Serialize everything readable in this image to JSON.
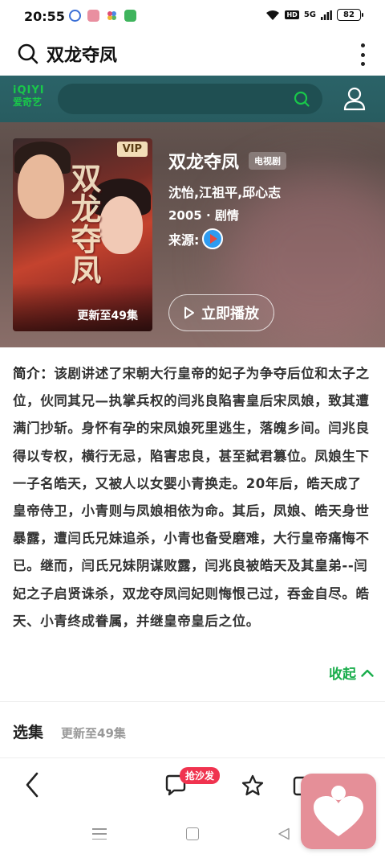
{
  "status_bar": {
    "time": "20:55",
    "network": "5G",
    "hd": "HD",
    "battery": "82"
  },
  "search_header": {
    "query": "双龙夺凤"
  },
  "iqiyi": {
    "logo_en": "iQIYI",
    "logo_cn": "爱奇艺"
  },
  "show": {
    "poster_badge": "VIP",
    "poster_update": "更新至49集",
    "title": "双龙夺凤",
    "type_badge": "电视剧",
    "cast": "沈怡,江祖平,邱心志",
    "meta": "2005 · 剧情",
    "source_label": "来源:",
    "play_label": "立即播放"
  },
  "synopsis": {
    "label": "简介：",
    "text": "该剧讲述了宋朝大行皇帝的妃子为争夺后位和太子之位，伙同其兄—执掌兵权的闫兆良陷害皇后宋凤娘，致其遭满门抄斩。身怀有孕的宋凤娘死里逃生，落魄乡间。闫兆良得以专权，横行无忌，陷害忠良，甚至弑君篡位。凤娘生下一子名皓天，又被人以女婴小青换走。20年后，皓天成了皇帝侍卫，小青则与凤娘相依为命。其后，凤娘、皓天身世暴露，遭闫氏兄妹追杀，小青也备受磨难，大行皇帝痛悔不已。继而，闫氏兄妹阴谋败露，闫兆良被皓天及其皇弟--闫妃之子启贤诛杀，双龙夺凤闫妃则悔恨己过，吞金自尽。皓天、小青终成眷属，并继皇帝皇后之位。",
    "collapse_label": "收起"
  },
  "episodes": {
    "title": "选集",
    "update": "更新至49集"
  },
  "bottom_bar": {
    "sofa_badge": "抢沙发"
  },
  "colors": {
    "accent_green": "#1aad4c",
    "iqiyi_green": "#19c84a",
    "badge_red": "#f0334f",
    "float_pink": "#e58f98"
  }
}
